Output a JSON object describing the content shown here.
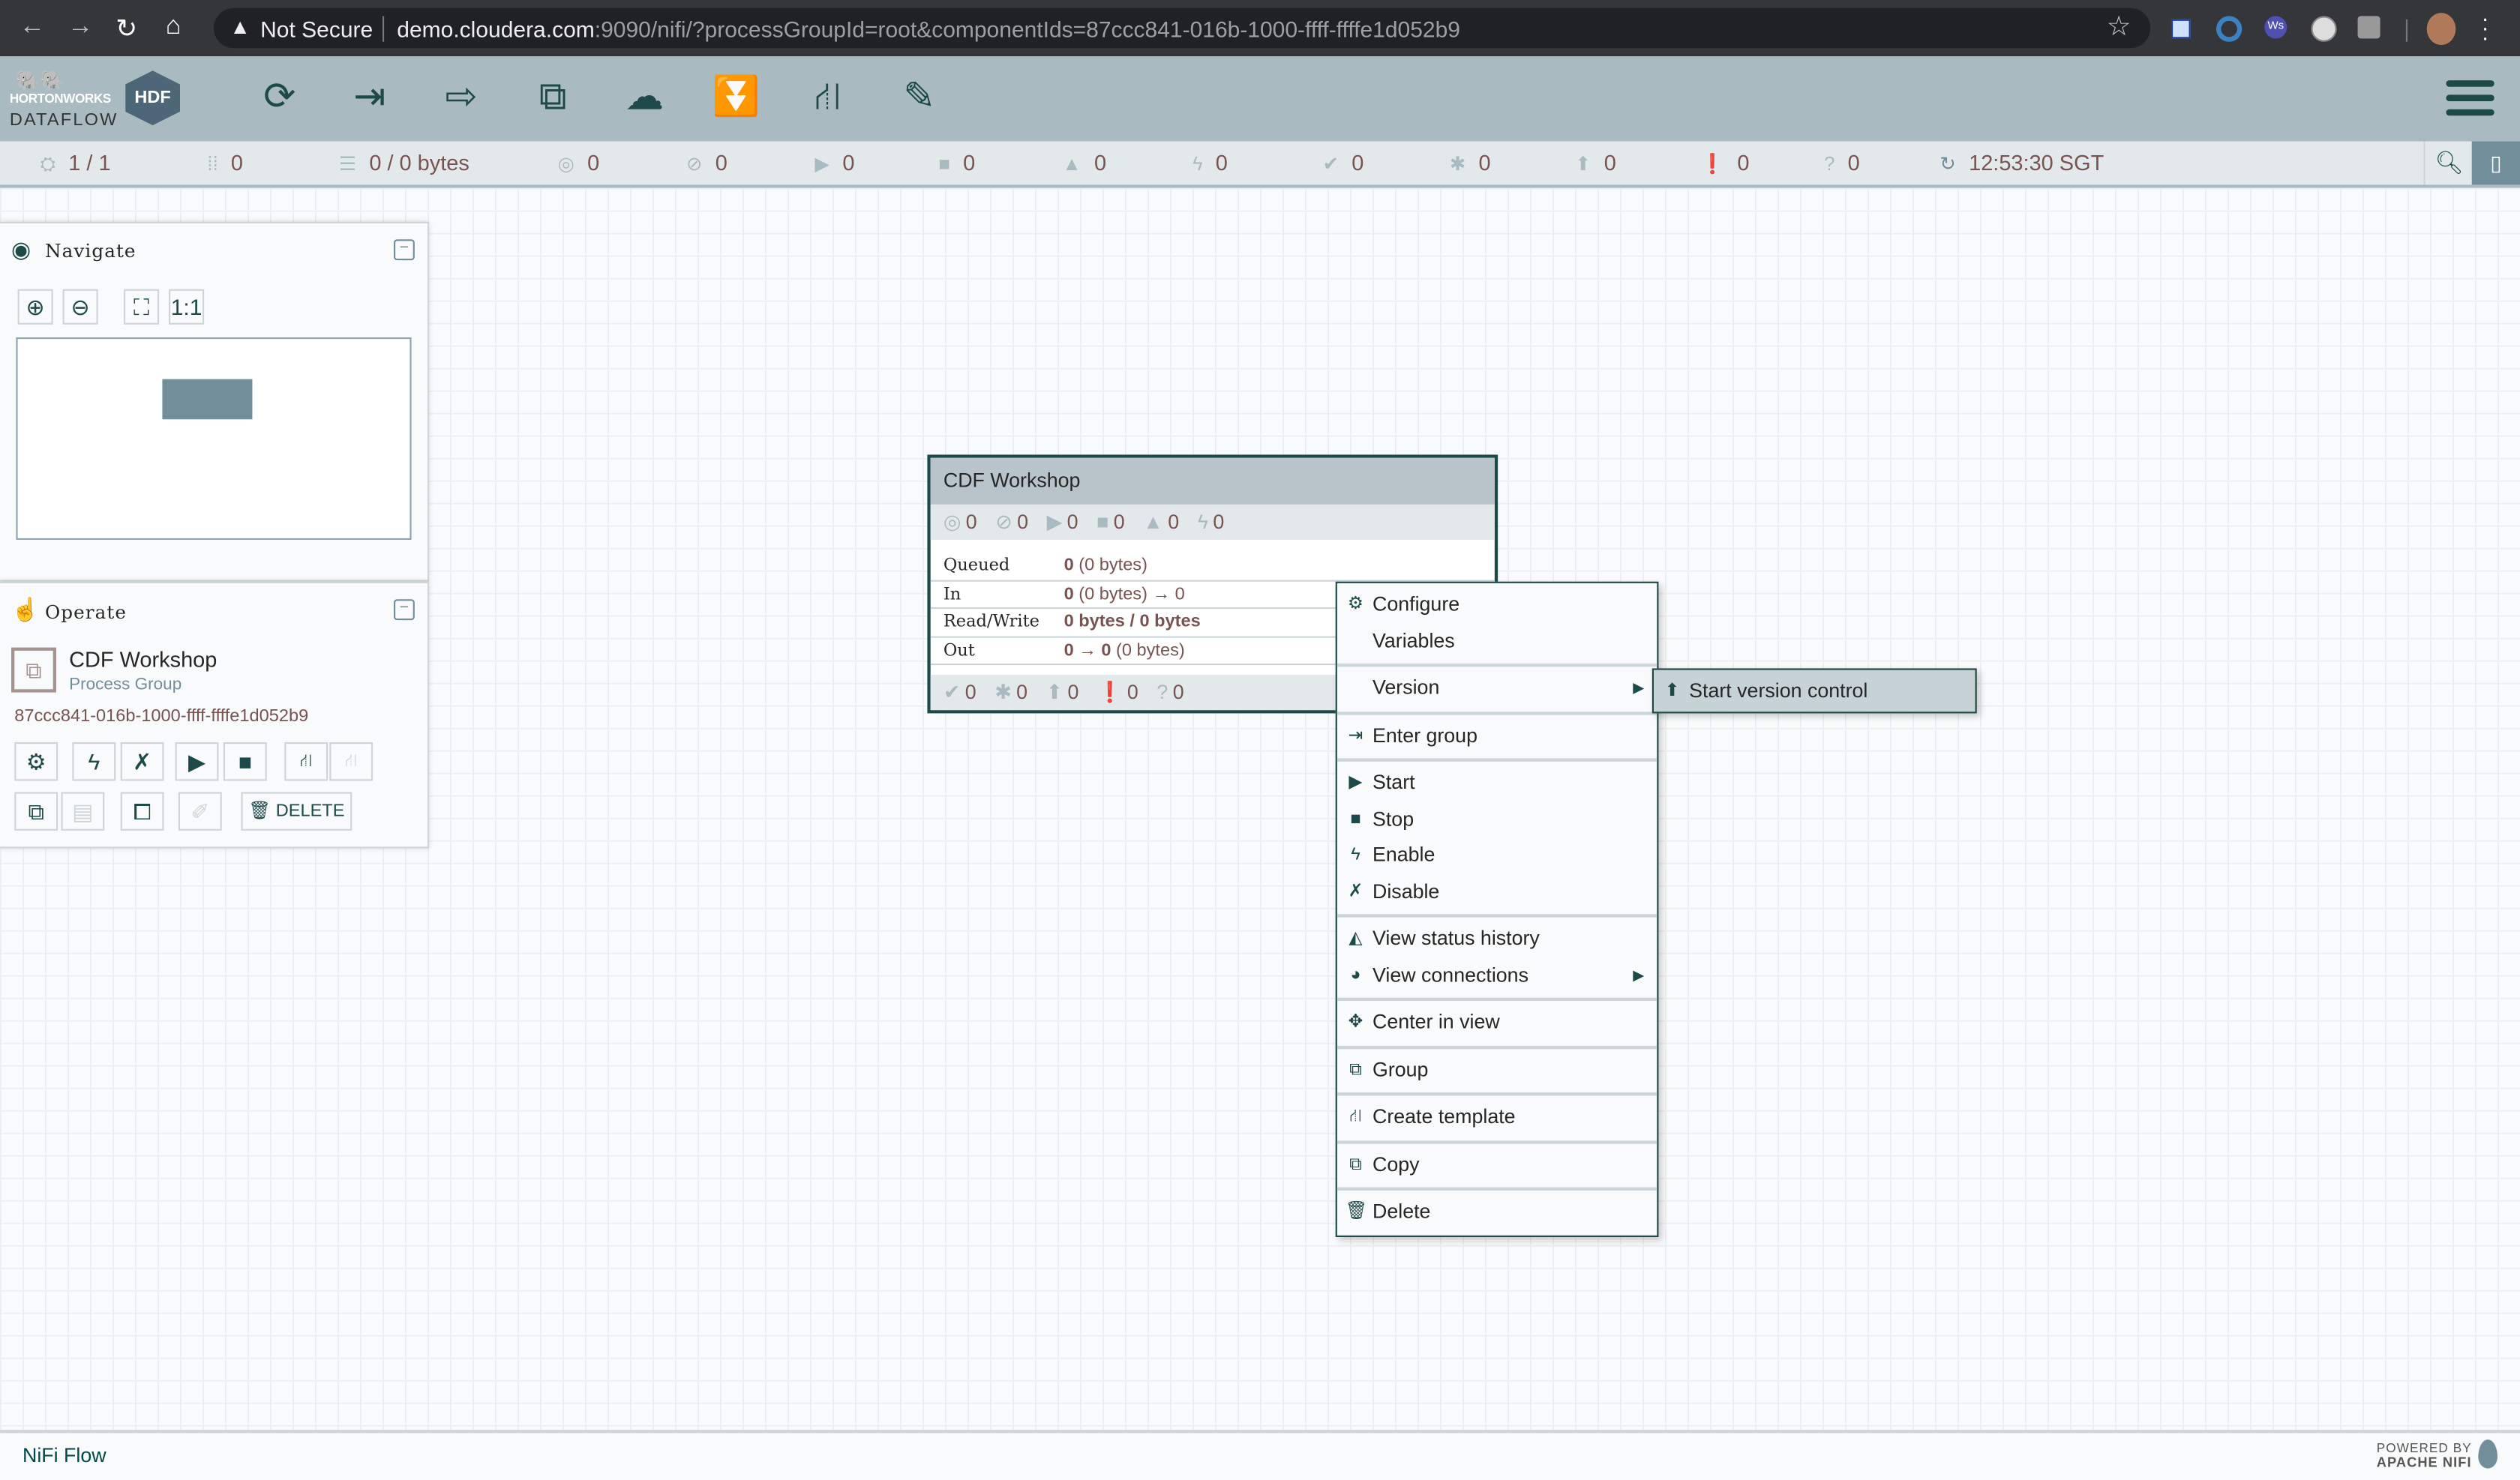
{
  "browser": {
    "security_label": "Not Secure",
    "url_host": "demo.cloudera.com",
    "url_rest": ":9090/nifi/?processGroupId=root&componentIds=87ccc841-016b-1000-ffff-ffffe1d052b9",
    "extension_label": "Ws"
  },
  "header": {
    "logo_brand": "HORTONWORKS",
    "logo_product": "DATAFLOW",
    "logo_badge": "HDF",
    "toolbar": [
      "processor",
      "input-port",
      "output-port",
      "process-group",
      "remote-process-group",
      "funnel",
      "template",
      "label"
    ]
  },
  "status_bar": {
    "threads": "1 / 1",
    "tokens": "0",
    "queued": "0 / 0 bytes",
    "transmitting": "0",
    "not_transmitting": "0",
    "running": "0",
    "stopped": "0",
    "invalid": "0",
    "disabled": "0",
    "up_to_date": "0",
    "locally_modified": "0",
    "stale": "0",
    "locally_modified_stale": "0",
    "sync_failure": "0",
    "refreshed": "12:53:30 SGT"
  },
  "navigate": {
    "title": "Navigate"
  },
  "operate": {
    "title": "Operate",
    "component_name": "CDF Workshop",
    "component_type": "Process Group",
    "component_id": "87ccc841-016b-1000-ffff-ffffe1d052b9",
    "delete_label": "DELETE"
  },
  "process_group": {
    "name": "CDF Workshop",
    "top_counts": {
      "transmitting": "0",
      "not_transmitting": "0",
      "running": "0",
      "stopped": "0",
      "invalid": "0",
      "disabled": "0"
    },
    "rows": [
      {
        "label": "Queued",
        "bold": "0",
        "rest": " (0 bytes)"
      },
      {
        "label": "In",
        "bold": "0",
        "rest": " (0 bytes) → 0"
      },
      {
        "label": "Read/Write",
        "bold": "0 bytes / 0 bytes",
        "rest": ""
      },
      {
        "label": "Out",
        "bold": "0 → 0",
        "rest": " (0 bytes)"
      }
    ],
    "bottom_counts": {
      "up_to_date": "0",
      "locally_modified": "0",
      "stale": "0",
      "locally_modified_stale": "0",
      "sync_failure": "0"
    }
  },
  "context_menu": {
    "configure": "Configure",
    "variables": "Variables",
    "version": "Version",
    "enter_group": "Enter group",
    "start": "Start",
    "stop": "Stop",
    "enable": "Enable",
    "disable": "Disable",
    "view_status_history": "View status history",
    "view_connections": "View connections",
    "center_in_view": "Center in view",
    "group": "Group",
    "create_template": "Create template",
    "copy": "Copy",
    "delete": "Delete"
  },
  "version_submenu": {
    "start_version_control": "Start version control"
  },
  "footer": {
    "breadcrumb": "NiFi Flow",
    "powered_by": "POWERED BY",
    "apache_nifi": "APACHE NIFI"
  },
  "colors": {
    "accent": "#1d4a48",
    "header": "#aabac1",
    "value_text": "#775351"
  }
}
